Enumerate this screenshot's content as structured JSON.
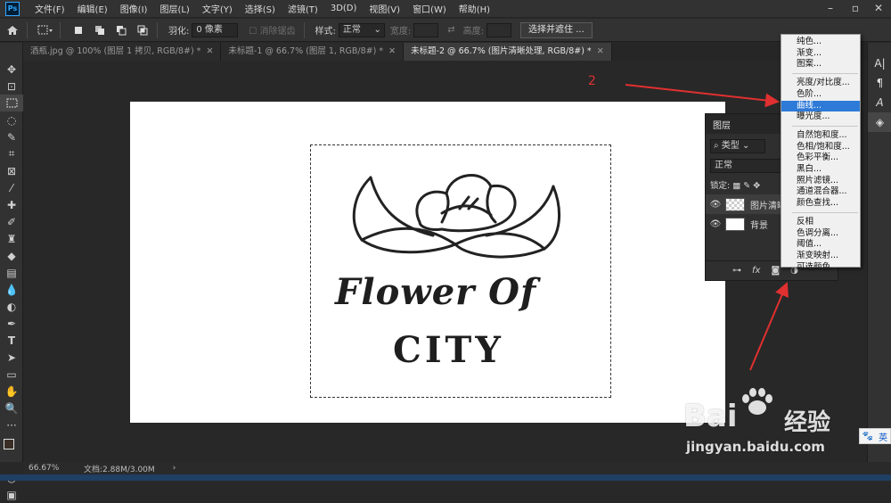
{
  "app": {
    "logo": "Ps"
  },
  "menu": [
    "文件(F)",
    "编辑(E)",
    "图像(I)",
    "图层(L)",
    "文字(Y)",
    "选择(S)",
    "滤镜(T)",
    "3D(D)",
    "视图(V)",
    "窗口(W)",
    "帮助(H)"
  ],
  "options": {
    "feather_label": "羽化:",
    "feather_value": "0 像素",
    "antialias_label": "消除锯齿",
    "style_label": "样式:",
    "style_value": "正常",
    "width_label": "宽度:",
    "height_label": "高度:",
    "select_mask_button": "选择并遮住 ..."
  },
  "tabs": [
    {
      "label": "酒瓶.jpg @ 100% (图层 1 拷贝, RGB/8#) *",
      "active": false
    },
    {
      "label": "未标题-1 @ 66.7% (图层 1, RGB/8#) *",
      "active": false
    },
    {
      "label": "未标题-2 @ 66.7% (图片清晰处理, RGB/8#) *",
      "active": true
    }
  ],
  "canvas": {
    "line1": "Flower Of",
    "line2": "CITY"
  },
  "layers_panel": {
    "title": "图层",
    "filter_kind": "类型",
    "blend_mode": "正常",
    "lock_label": "锁定:",
    "layers": [
      {
        "name": "图片清晰",
        "kind": "transparent"
      },
      {
        "name": "背景",
        "kind": "white"
      }
    ],
    "footer_fx": "fx"
  },
  "adjustment_menu": {
    "groups": [
      [
        "纯色...",
        "渐变...",
        "图案..."
      ],
      [
        "亮度/对比度...",
        "色阶...",
        "曲线...",
        "曝光度..."
      ],
      [
        "自然饱和度...",
        "色相/饱和度...",
        "色彩平衡...",
        "黑白...",
        "照片滤镜...",
        "通道混合器...",
        "颜色查找..."
      ],
      [
        "反相",
        "色调分离...",
        "阈值...",
        "渐变映射...",
        "可选颜色..."
      ]
    ],
    "highlighted": "曲线..."
  },
  "annotation": {
    "step_number": "2",
    "color": "#e03030"
  },
  "status": {
    "zoom": "66.67%",
    "doc_info": "文档:2.88M/3.00M"
  },
  "watermark": {
    "brand": "Bai",
    "brand2": "经验",
    "url": "jingyan.baidu.com"
  },
  "ime": {
    "label": "英"
  },
  "colors": {
    "highlight": "#2e7ad8",
    "ps_blue": "#31a8ff",
    "arrow_red": "#e03030"
  }
}
